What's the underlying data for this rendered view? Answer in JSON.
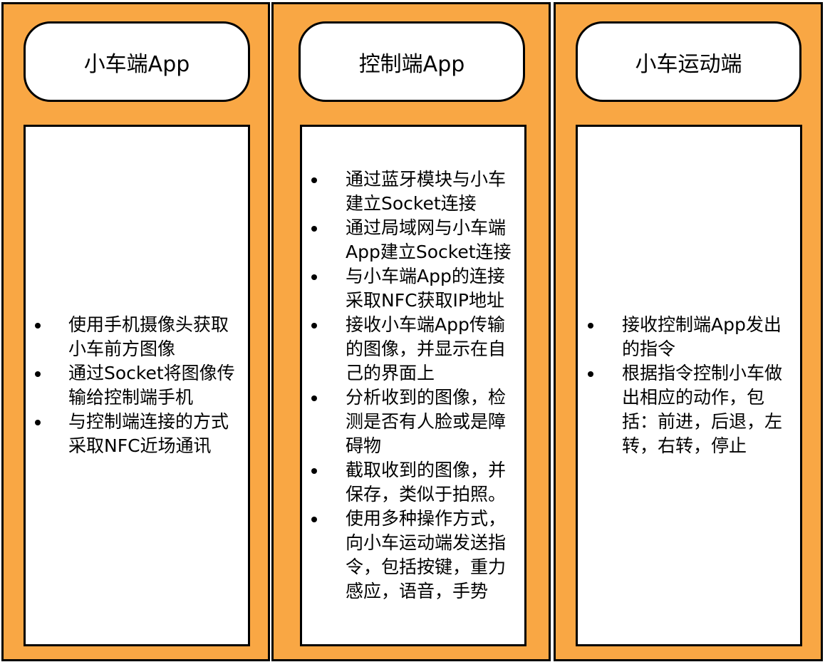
{
  "columns": [
    {
      "title": "小车端App",
      "items": [
        "使用手机摄像头获取小车前方图像",
        "通过Socket将图像传输给控制端手机",
        "与控制端连接的方式采取NFC近场通讯"
      ]
    },
    {
      "title": "控制端App",
      "items": [
        "通过蓝牙模块与小车建立Socket连接",
        "通过局域网与小车端App建立Socket连接",
        "与小车端App的连接采取NFC获取IP地址",
        "接收小车端App传输的图像，并显示在自己的界面上",
        "分析收到的图像，检测是否有人脸或是障碍物",
        "截取收到的图像，并保存，类似于拍照。",
        "使用多种操作方式，向小车运动端发送指令，包括按键，重力感应，语音，手势"
      ]
    },
    {
      "title": "小车运动端",
      "items": [
        "接收控制端App发出的指令",
        "根据指令控制小车做出相应的动作，包括：前进，后退，左转，右转，停止"
      ]
    }
  ],
  "colors": {
    "column_fill": "#F9A744",
    "box_fill": "#FFFFFF",
    "border": "#000000"
  }
}
